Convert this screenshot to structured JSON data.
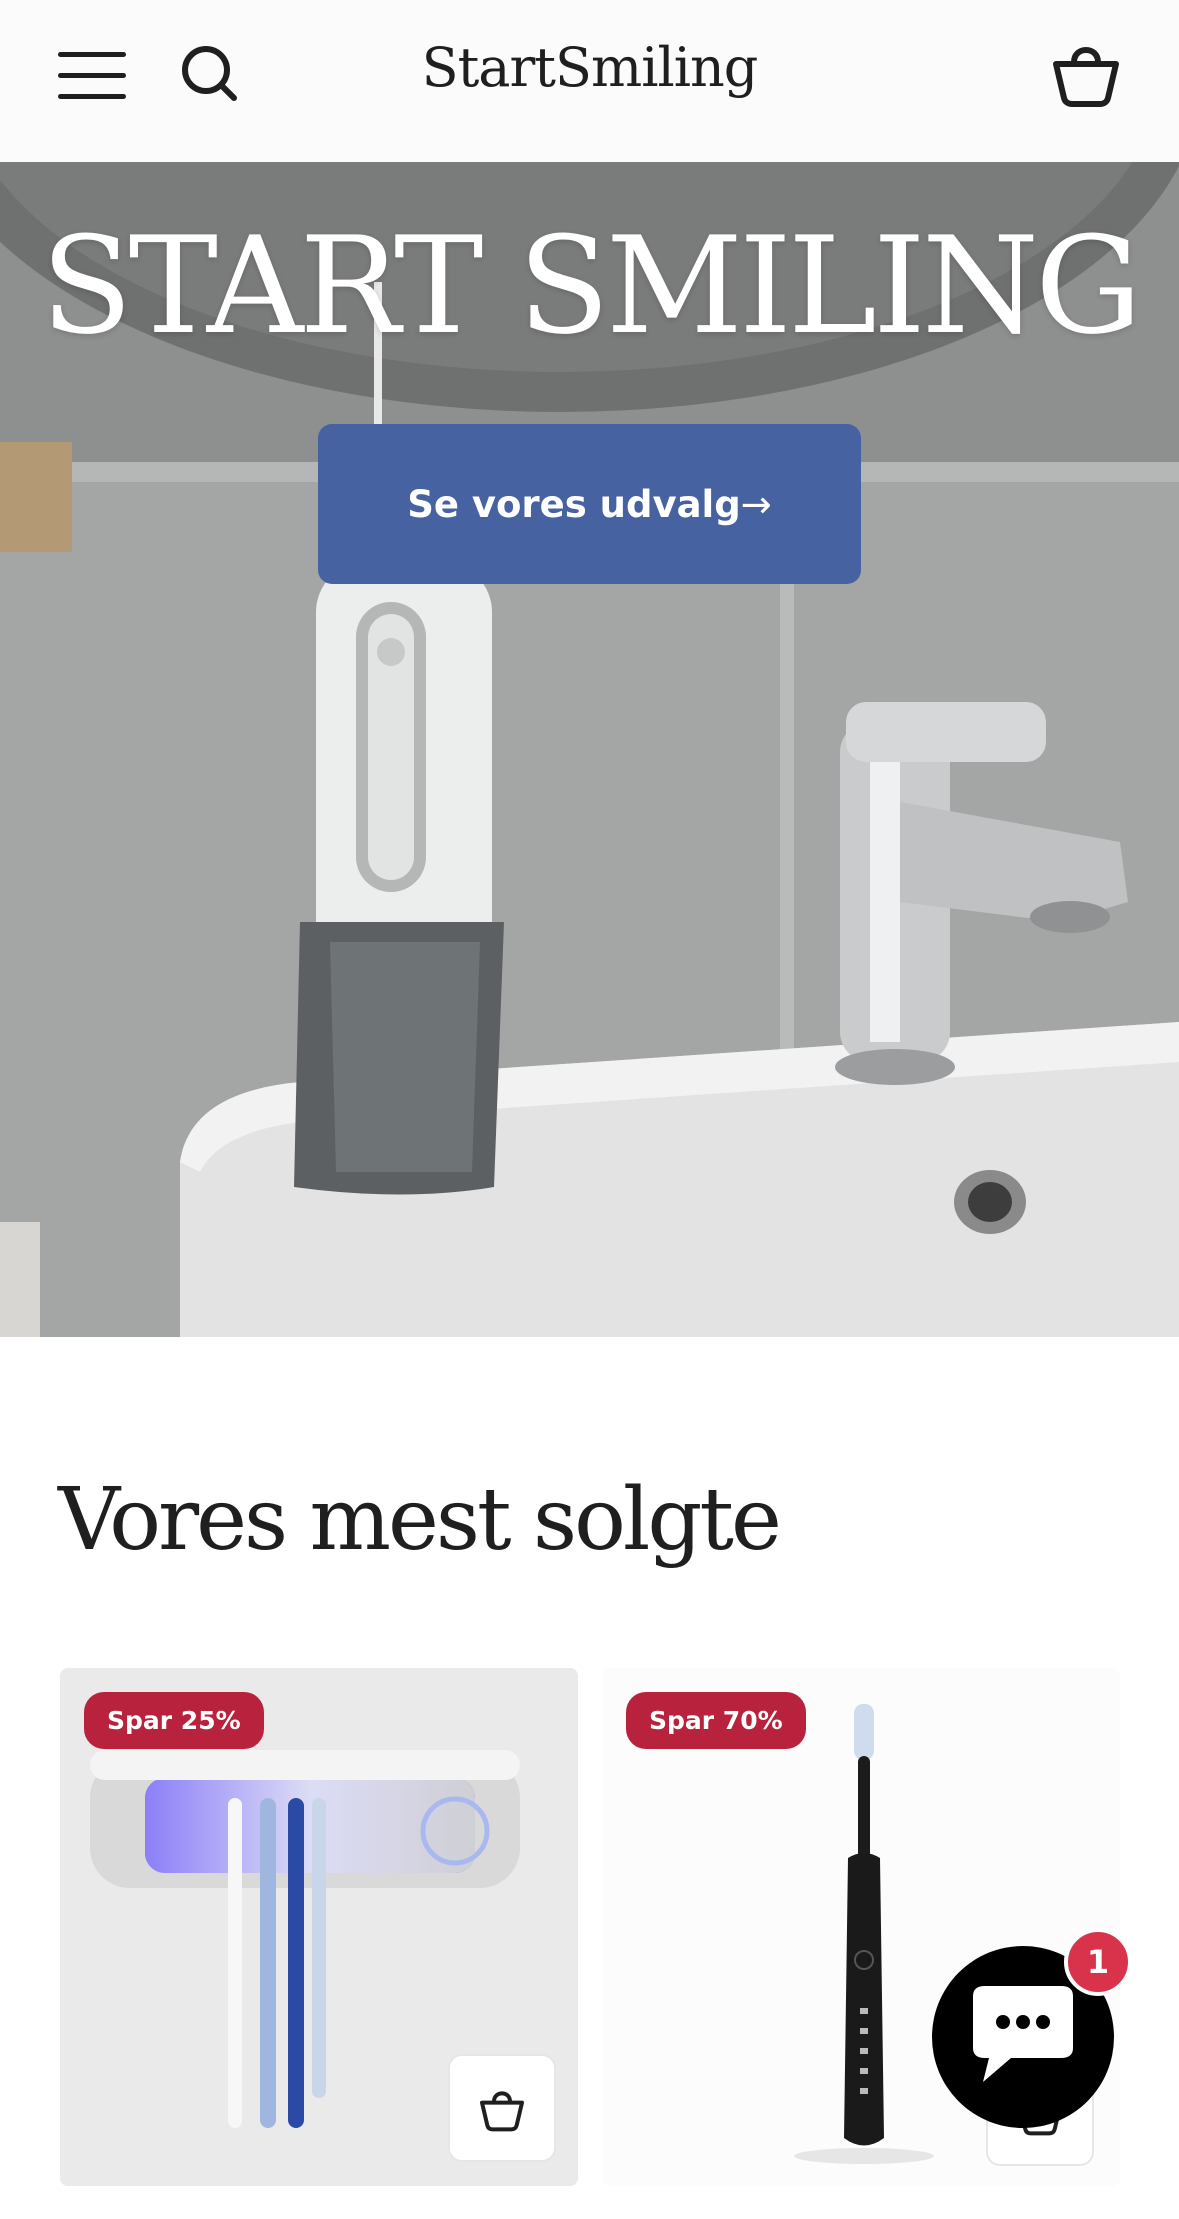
{
  "header": {
    "brand": "StartSmiling",
    "menu_icon": "hamburger-menu-icon",
    "search_icon": "search-icon",
    "cart_icon": "basket-icon"
  },
  "hero": {
    "title": "START SMILING",
    "cta_label": "Se vores udvalg",
    "cta_arrow": "→",
    "image": "bathroom-sink-with-water-flosser-and-faucet",
    "cta_color": "#4762a1"
  },
  "best_sellers": {
    "title": "Vores mest solgte",
    "products": [
      {
        "badge": "Spar 25%",
        "image": "uv-toothbrush-holder-wall-mounted",
        "add_icon": "basket-icon"
      },
      {
        "badge": "Spar 70%",
        "image": "black-electric-toothbrush",
        "add_icon": "basket-icon"
      }
    ],
    "badge_color": "#b8223c"
  },
  "chat_widget": {
    "icon": "chat-bubble-icon",
    "unread_count": "1",
    "badge_color": "#d8334a"
  }
}
